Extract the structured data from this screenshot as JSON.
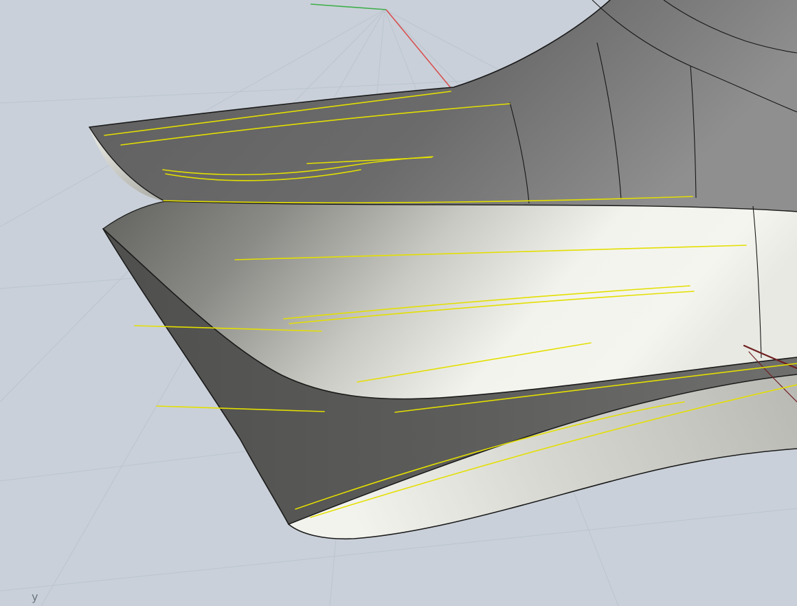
{
  "app": {
    "name": "3d-cad-viewport",
    "view": "perspective-shaded"
  },
  "viewport": {
    "axis_label_y": "y",
    "colors": {
      "background": "#c9d0d9",
      "grid": "#a7b1bd",
      "axis_x": "#d85050",
      "axis_y": "#3fae4a",
      "edge": "#1a1a1a",
      "isocurve": "#161616",
      "curve_selected": "#e3df00",
      "naked_edge": "#6e1f1f",
      "surface_dark": "#626262",
      "surface_mid": "#9a9a95",
      "surface_light": "#f3f3ed"
    }
  }
}
